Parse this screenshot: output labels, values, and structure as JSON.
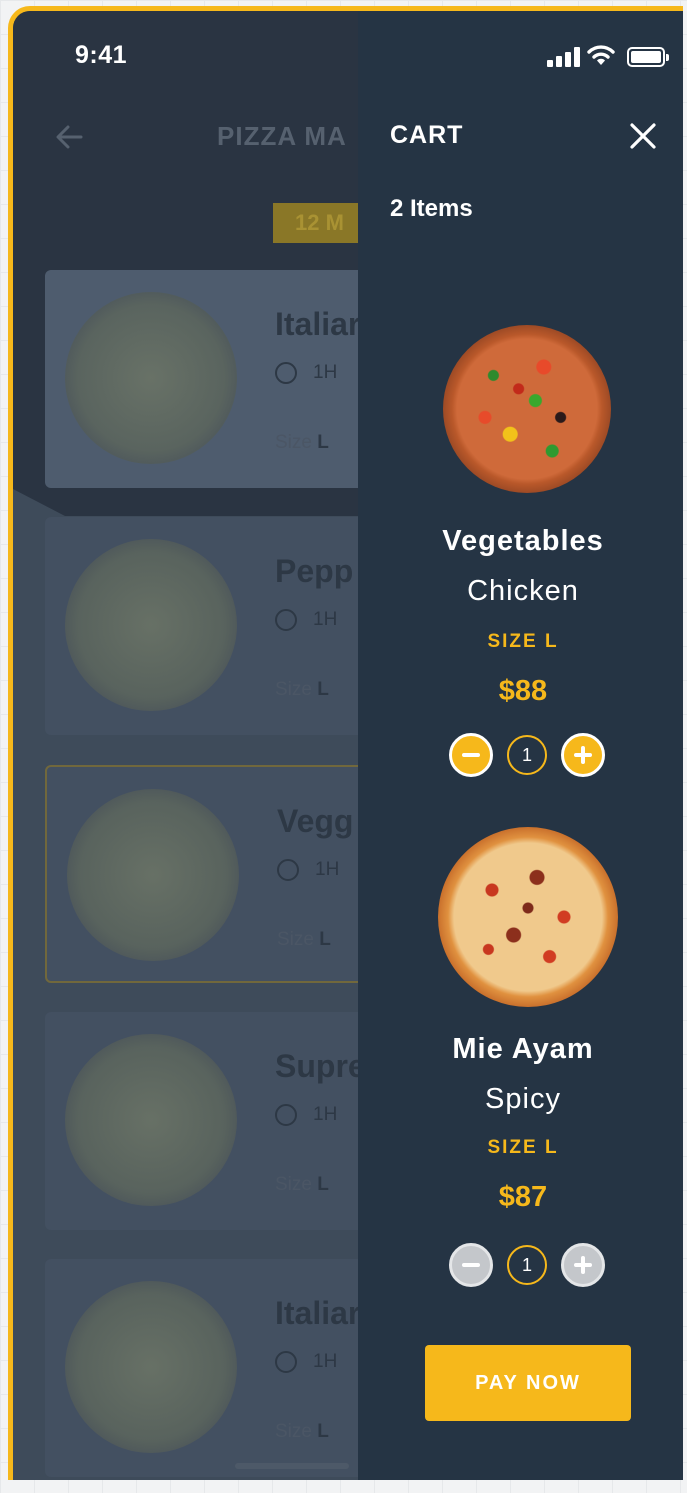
{
  "status_bar": {
    "time": "9:41"
  },
  "background_screen": {
    "title": "PIZZA MA",
    "badge": "12 M",
    "cards": [
      {
        "name": "Italiar",
        "time": "1H",
        "size_label": "Size",
        "size_value": "L"
      },
      {
        "name": "Pepp",
        "time": "1H",
        "size_label": "Size",
        "size_value": "L"
      },
      {
        "name": "Vegg",
        "time": "1H",
        "size_label": "Size",
        "size_value": "L"
      },
      {
        "name": "Supre",
        "time": "1H",
        "size_label": "Size",
        "size_value": "L"
      },
      {
        "name": "Italiar",
        "time": "1H",
        "size_label": "Size",
        "size_value": "L"
      }
    ]
  },
  "cart": {
    "title": "CART",
    "count": "2 Items",
    "items": [
      {
        "name": "Vegetables",
        "variant": "Chicken",
        "size": "SIZE L",
        "price": "$88",
        "quantity": "1"
      },
      {
        "name": "Mie Ayam",
        "variant": "Spicy",
        "size": "SIZE L",
        "price": "$87",
        "quantity": "1"
      }
    ],
    "pay_label": "PAY NOW"
  },
  "colors": {
    "accent": "#f6b81b",
    "drawer": "#253444",
    "dim_bg": "#3e4b5a"
  }
}
